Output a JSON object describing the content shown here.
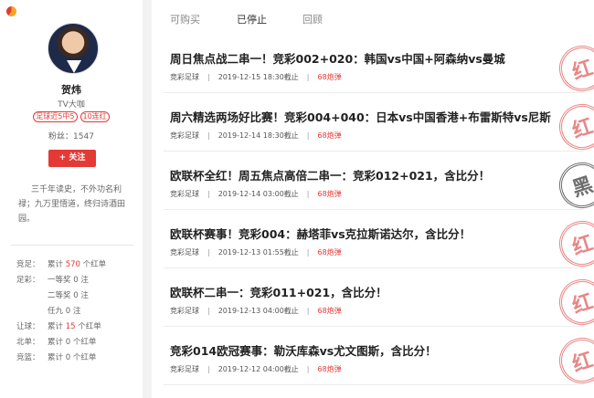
{
  "profile": {
    "name": "贺炜",
    "title": "TV大咖",
    "badges": [
      "足球近5中5",
      "10连红"
    ],
    "fans_label": "粉丝：",
    "fans": "1547",
    "follow_label": "+ 关注",
    "bio": "三千年读史，不外功名利禄；九万里悟道，终归诗酒田园。"
  },
  "stats": [
    {
      "key": "竞足：",
      "pre": "累计 ",
      "value": "570",
      "post": " 个红单",
      "highlight": true
    },
    {
      "key": "足彩：",
      "pre": "一等奖 ",
      "value": "0",
      "post": " 注",
      "highlight": false
    },
    {
      "key": "",
      "pre": "二等奖 ",
      "value": "0",
      "post": " 注",
      "highlight": false
    },
    {
      "key": "",
      "pre": "任九 ",
      "value": "0",
      "post": " 注",
      "highlight": false
    },
    {
      "key": "让球：",
      "pre": "累计 ",
      "value": "15",
      "post": " 个红单",
      "highlight": true
    },
    {
      "key": "北单：",
      "pre": "累计 ",
      "value": "0",
      "post": " 个红单",
      "highlight": false
    },
    {
      "key": "竞篮：",
      "pre": "累计 ",
      "value": "0",
      "post": " 个红单",
      "highlight": false
    }
  ],
  "tabs": [
    "可购买",
    "已停止",
    "回顾"
  ],
  "articles": [
    {
      "title": "周日焦点战二串一！竞彩002+020：韩国vs中国+阿森纳vs曼城",
      "category": "竞彩足球",
      "time": "2019-12-15 18:30截止",
      "count": "68炮弹",
      "stamp": "红",
      "stamp_color": "#e57373"
    },
    {
      "title": "周六精选两场好比赛！竞彩004+040：日本vs中国香港+布雷斯特vs尼斯",
      "category": "竞彩足球",
      "time": "2019-12-14 18:30截止",
      "count": "68炮弹",
      "stamp": "红",
      "stamp_color": "#e57373"
    },
    {
      "title": "欧联杯全红！周五焦点高倍二串一：竞彩012+021，含比分！",
      "category": "竞彩足球",
      "time": "2019-12-14 03:00截止",
      "count": "68炮弹",
      "stamp": "黑",
      "stamp_color": "#555555"
    },
    {
      "title": "欧联杯赛事！竞彩004：赫塔菲vs克拉斯诺达尔，含比分！",
      "category": "竞彩足球",
      "time": "2019-12-13 01:55截止",
      "count": "68炮弹",
      "stamp": "红",
      "stamp_color": "#e57373"
    },
    {
      "title": "欧联杯二串一：竞彩011+021，含比分！",
      "category": "竞彩足球",
      "time": "2019-12-13 04:00截止",
      "count": "68炮弹",
      "stamp": "红",
      "stamp_color": "#e57373"
    },
    {
      "title": "竞彩014欧冠赛事：勒沃库森vs尤文图斯，含比分！",
      "category": "竞彩足球",
      "time": "2019-12-12 04:00截止",
      "count": "68炮弹",
      "stamp": "红",
      "stamp_color": "#e57373"
    }
  ]
}
